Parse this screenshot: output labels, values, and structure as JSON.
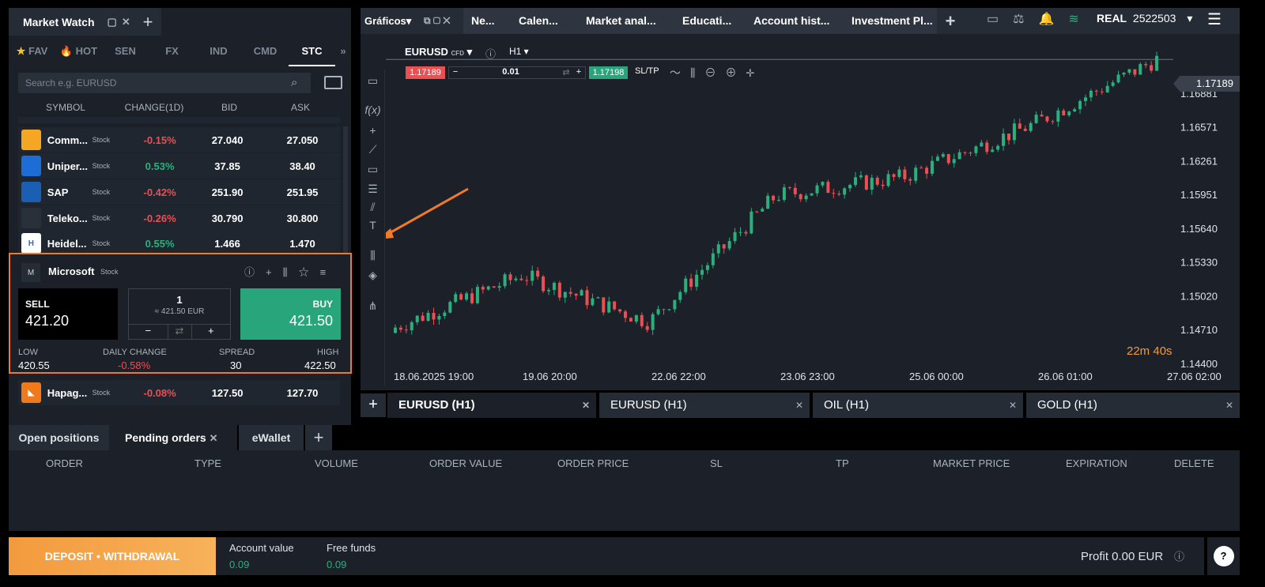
{
  "market_watch": {
    "title": "Market Watch",
    "tabs": [
      "FAV",
      "HOT",
      "SEN",
      "FX",
      "IND",
      "CMD",
      "STC"
    ],
    "search_placeholder": "Search e.g. EURUSD",
    "columns": [
      "SYMBOL",
      "CHANGE(1D)",
      "BID",
      "ASK"
    ],
    "rows": [
      {
        "symbol": "Comm...",
        "type": "Stock",
        "change": "-0.15%",
        "bid": "27.040",
        "ask": "27.050",
        "color": "#f5a623",
        "dir": "down"
      },
      {
        "symbol": "Uniper...",
        "type": "Stock",
        "change": "0.53%",
        "bid": "37.85",
        "ask": "38.40",
        "color": "#1c6ed6",
        "dir": "up"
      },
      {
        "symbol": "SAP",
        "type": "Stock",
        "change": "-0.42%",
        "bid": "251.90",
        "ask": "251.95",
        "color": "#1b5fb5",
        "dir": "down"
      },
      {
        "symbol": "Teleko...",
        "type": "Stock",
        "change": "-0.26%",
        "bid": "30.790",
        "ask": "30.800",
        "color": "#2a303a",
        "dir": "down"
      },
      {
        "symbol": "Heidel...",
        "type": "Stock",
        "change": "0.55%",
        "bid": "1.466",
        "ask": "1.470",
        "color": "#ffffff",
        "dir": "up"
      }
    ],
    "bottom_row": {
      "symbol": "Hapag...",
      "type": "Stock",
      "change": "-0.08%",
      "bid": "127.50",
      "ask": "127.70",
      "color": "#f07a1a"
    },
    "selected": {
      "name": "Microsoft",
      "type": "Stock",
      "logo_letter": "M",
      "sell_label": "SELL",
      "sell_price": "421.20",
      "qty": "1",
      "qty_value": "≈ 421.50 EUR",
      "buy_label": "BUY",
      "buy_price": "421.50",
      "low_label": "LOW",
      "low": "420.55",
      "daily_label": "DAILY CHANGE",
      "daily": "-0.58%",
      "spread_label": "SPREAD",
      "spread": "30",
      "high_label": "HIGH",
      "high": "422.50"
    }
  },
  "chart_tabs": [
    "Gráficos",
    "Ne...",
    "Calen...",
    "Market anal...",
    "Educati...",
    "Account hist...",
    "Investment Pl..."
  ],
  "account": {
    "mode": "REAL",
    "number": "2522503"
  },
  "chart": {
    "symbol": "EURUSD",
    "cfd": "CFD",
    "timeframe": "H1",
    "bid": "1.17189",
    "lot": "0.01",
    "ask": "1.17198",
    "sltp": "SL/TP",
    "current_price": "1.17189",
    "countdown": "22m 40s",
    "price_labels": [
      "1.16881",
      "1.16571",
      "1.16261",
      "1.15951",
      "1.15640",
      "1.15330",
      "1.15020",
      "1.14710",
      "1.14400"
    ],
    "time_labels": [
      "18.06.2025 19:00",
      "19.06 20:00",
      "22.06 22:00",
      "23.06 23:00",
      "25.06 00:00",
      "26.06 01:00",
      "27.06 02:00"
    ]
  },
  "chart_data": {
    "type": "candlestick",
    "series_hint": "EURUSD H1 close approximations",
    "x": [
      "18.06.2025 19:00",
      "19.06 20:00",
      "22.06 22:00",
      "23.06 23:00",
      "25.06 00:00",
      "26.06 01:00",
      "27.06 02:00"
    ],
    "values": [
      1.1473,
      1.1521,
      1.1478,
      1.1594,
      1.1611,
      1.1658,
      1.1719
    ],
    "ylim": [
      1.144,
      1.173
    ]
  },
  "bottom_chart_tabs": [
    "EURUSD (H1)",
    "EURUSD (H1)",
    "OIL (H1)",
    "GOLD (H1)"
  ],
  "orders": {
    "tabs": [
      "Open positions",
      "Pending orders",
      "eWallet"
    ],
    "columns": [
      "ORDER",
      "TYPE",
      "VOLUME",
      "ORDER VALUE",
      "ORDER PRICE",
      "SL",
      "TP",
      "MARKET PRICE",
      "EXPIRATION",
      "DELETE"
    ]
  },
  "footer": {
    "deposit": "DEPOSIT • WITHDRAWAL",
    "account_value_label": "Account value",
    "account_value": "0.09",
    "free_funds_label": "Free funds",
    "free_funds": "0.09",
    "profit": "Profit 0.00 EUR"
  }
}
